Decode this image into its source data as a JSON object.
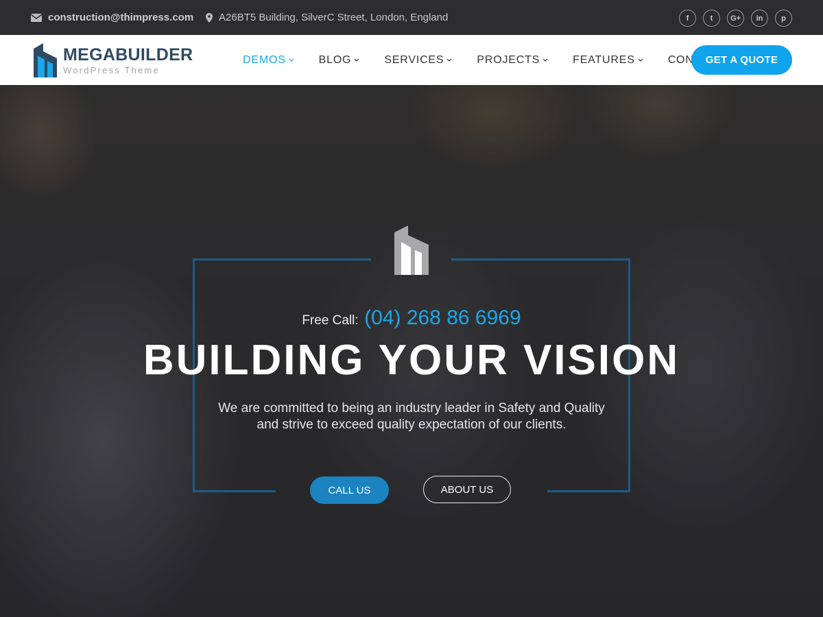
{
  "topbar": {
    "email": "construction@thimpress.com",
    "address": "A26BT5 Building, SilverC Street, London, England",
    "social": [
      {
        "icon": "facebook-icon",
        "glyph": "f"
      },
      {
        "icon": "twitter-icon",
        "glyph": "t"
      },
      {
        "icon": "google-plus-icon",
        "glyph": "G+"
      },
      {
        "icon": "linkedin-icon",
        "glyph": "in"
      },
      {
        "icon": "pinterest-icon",
        "glyph": "p"
      }
    ]
  },
  "header": {
    "logo_title": "MEGABUILDER",
    "logo_subtitle": "WordPress Theme",
    "nav": [
      {
        "label": "DEMOS",
        "dropdown": true,
        "active": true
      },
      {
        "label": "BLOG",
        "dropdown": true
      },
      {
        "label": "SERVICES",
        "dropdown": true
      },
      {
        "label": "PROJECTS",
        "dropdown": true
      },
      {
        "label": "FEATURES",
        "dropdown": true
      },
      {
        "label": "CONTACT",
        "dropdown": false
      }
    ],
    "quote_button": "GET A QUOTE"
  },
  "hero": {
    "free_call_label": "Free Call:",
    "phone": "(04) 268 86 6969",
    "headline": "BUILDING YOUR VISION",
    "tagline_line1": "We are committed to being an industry leader in Safety and Quality",
    "tagline_line2": "and strive to exceed quality expectation of our clients.",
    "call_button": "CALL US",
    "about_button": "ABOUT US"
  },
  "colors": {
    "accent": "#1ba7e8",
    "quote_button": "#0fa4ec",
    "call_button": "#1a83c0",
    "frame": "#1c5d87",
    "topbar_bg": "#2d2d30",
    "logo_text": "#2f4a63"
  }
}
